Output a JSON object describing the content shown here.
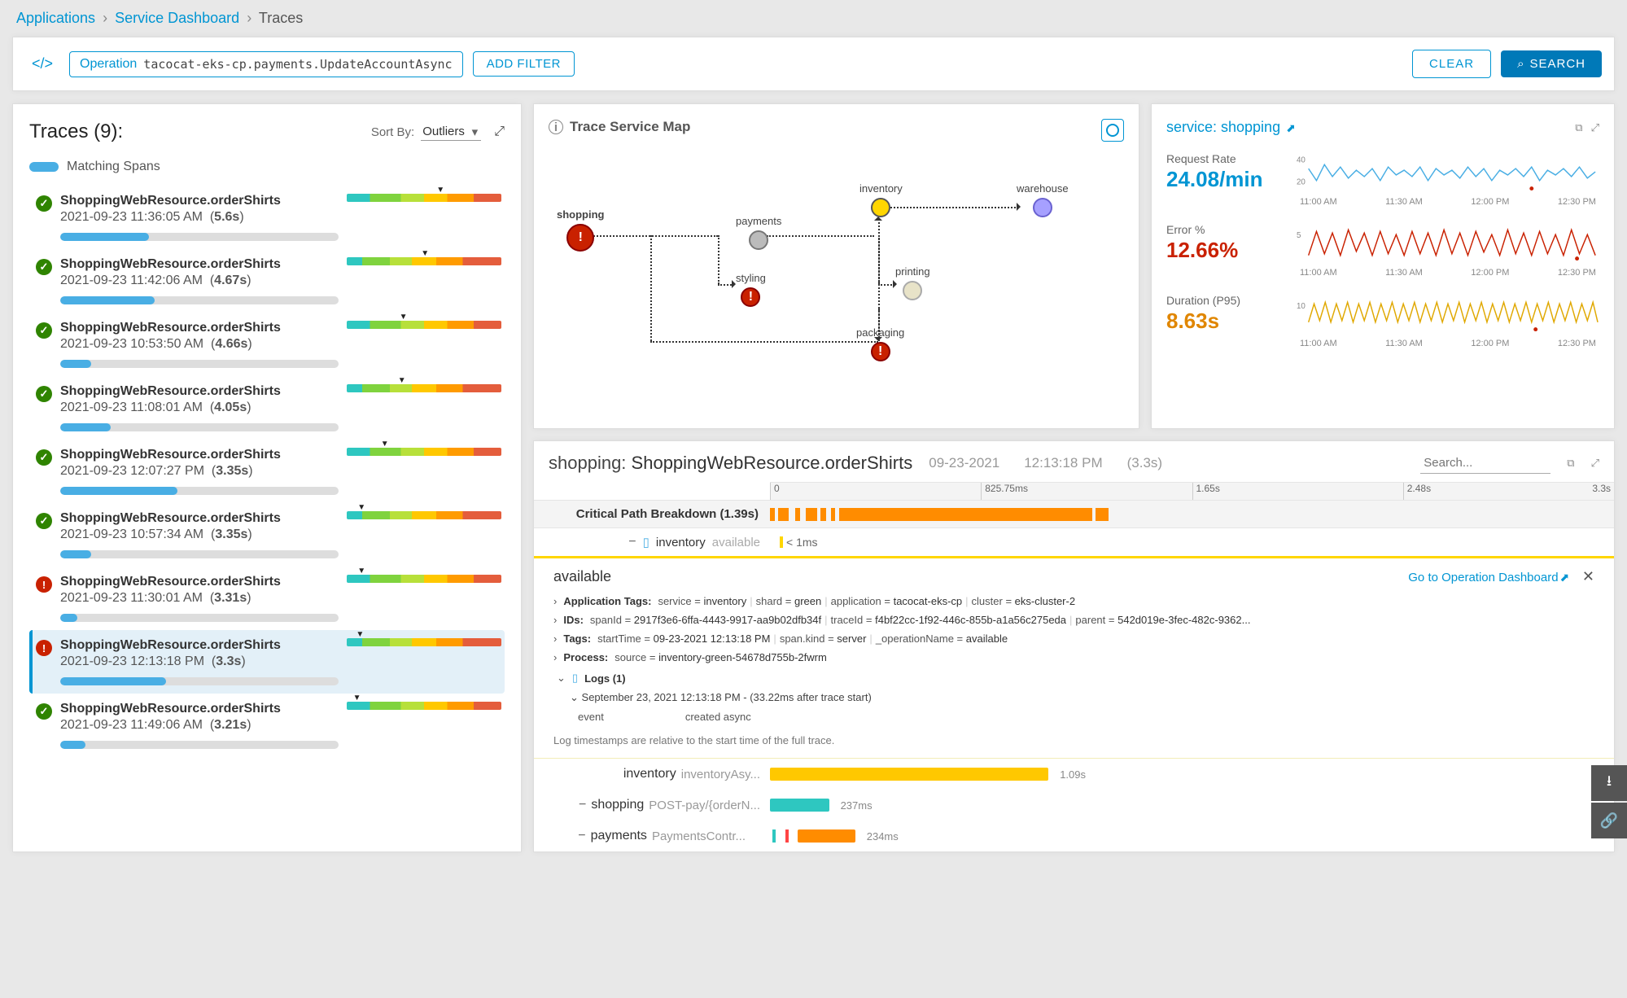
{
  "breadcrumb": {
    "items": [
      "Applications",
      "Service Dashboard",
      "Traces"
    ]
  },
  "filter": {
    "label": "Operation",
    "value": "tacocat-eks-cp.payments.UpdateAccountAsync",
    "addFilter": "ADD FILTER",
    "clear": "CLEAR",
    "search": "SEARCH"
  },
  "traces": {
    "title": "Traces (9):",
    "sortByLabel": "Sort By:",
    "sortByValue": "Outliers",
    "matching": "Matching Spans",
    "items": [
      {
        "name": "ShoppingWebResource.orderShirts",
        "ts": "2021-09-23 11:36:05 AM",
        "dur": "5.6s",
        "status": "ok",
        "marker": 58,
        "progress": 32
      },
      {
        "name": "ShoppingWebResource.orderShirts",
        "ts": "2021-09-23 11:42:06 AM",
        "dur": "4.67s",
        "status": "ok",
        "marker": 48,
        "progress": 34
      },
      {
        "name": "ShoppingWebResource.orderShirts",
        "ts": "2021-09-23 10:53:50 AM",
        "dur": "4.66s",
        "status": "ok",
        "marker": 34,
        "progress": 11
      },
      {
        "name": "ShoppingWebResource.orderShirts",
        "ts": "2021-09-23 11:08:01 AM",
        "dur": "4.05s",
        "status": "ok",
        "marker": 33,
        "progress": 18
      },
      {
        "name": "ShoppingWebResource.orderShirts",
        "ts": "2021-09-23 12:07:27 PM",
        "dur": "3.35s",
        "status": "ok",
        "marker": 22,
        "progress": 42
      },
      {
        "name": "ShoppingWebResource.orderShirts",
        "ts": "2021-09-23 10:57:34 AM",
        "dur": "3.35s",
        "status": "ok",
        "marker": 7,
        "progress": 11
      },
      {
        "name": "ShoppingWebResource.orderShirts",
        "ts": "2021-09-23 11:30:01 AM",
        "dur": "3.31s",
        "status": "err",
        "marker": 7,
        "progress": 6
      },
      {
        "name": "ShoppingWebResource.orderShirts",
        "ts": "2021-09-23 12:13:18 PM",
        "dur": "3.3s",
        "status": "err",
        "marker": 6,
        "progress": 38,
        "selected": true
      },
      {
        "name": "ShoppingWebResource.orderShirts",
        "ts": "2021-09-23 11:49:06 AM",
        "dur": "3.21s",
        "status": "ok",
        "marker": 4,
        "progress": 9
      }
    ]
  },
  "map": {
    "title": "Trace Service Map",
    "nodes": {
      "shopping": "shopping",
      "payments": "payments",
      "styling": "styling",
      "inventory": "inventory",
      "printing": "printing",
      "packaging": "packaging",
      "warehouse": "warehouse"
    }
  },
  "stats": {
    "link": "service: shopping",
    "requestRate": {
      "label": "Request Rate",
      "value": "24.08/min",
      "yticks": [
        "40",
        "20"
      ]
    },
    "errorPct": {
      "label": "Error %",
      "value": "12.66%",
      "yticks": [
        "5"
      ]
    },
    "duration": {
      "label": "Duration (P95)",
      "value": "8.63s",
      "yticks": [
        "10"
      ]
    },
    "xticks": [
      "11:00 AM",
      "11:30 AM",
      "12:00 PM",
      "12:30 PM"
    ]
  },
  "detail": {
    "title_service": "shopping:",
    "title_op": "ShoppingWebResource.orderShirts",
    "date": "09-23-2021",
    "time": "12:13:18 PM",
    "dur": "(3.3s)",
    "searchPlaceholder": "Search...",
    "ticks": [
      "0",
      "825.75ms",
      "1.65s",
      "2.48s",
      "3.3s"
    ],
    "critLabel": "Critical Path Breakdown (1.39s)",
    "inv_label": "inventory",
    "inv_status": "available",
    "inv_dur": "< 1ms",
    "span_title": "available",
    "dashboardLink": "Go to Operation Dashboard",
    "appTags": {
      "cat": "Application Tags:",
      "kv": [
        [
          "service",
          "inventory"
        ],
        [
          "shard",
          "green"
        ],
        [
          "application",
          "tacocat-eks-cp"
        ],
        [
          "cluster",
          "eks-cluster-2"
        ]
      ]
    },
    "ids": {
      "cat": "IDs:",
      "kv": [
        [
          "spanId",
          "2917f3e6-6ffa-4443-9917-aa9b02dfb34f"
        ],
        [
          "traceId",
          "f4bf22cc-1f92-446c-855b-a1a56c275eda"
        ],
        [
          "parent",
          "542d019e-3fec-482c-9362..."
        ]
      ]
    },
    "tags": {
      "cat": "Tags:",
      "kv": [
        [
          "startTime",
          "09-23-2021 12:13:18 PM"
        ],
        [
          "span.kind",
          "server"
        ],
        [
          "_operationName",
          "available"
        ]
      ]
    },
    "process": {
      "cat": "Process:",
      "kv": [
        [
          "source",
          "inventory-green-54678d755b-2fwrm"
        ]
      ]
    },
    "logs": {
      "label": "Logs  (1)",
      "ts": "September 23, 2021 12:13:18 PM - (33.22ms after trace start)",
      "event_k": "event",
      "event_v": "created async",
      "note": "Log timestamps are relative to the start time of the full trace."
    },
    "spans": [
      {
        "svc": "inventory",
        "op": "inventoryAsy...",
        "color": "#ffc800",
        "left": 0,
        "width": 33,
        "dur": "1.09s"
      },
      {
        "svc": "shopping",
        "op": "POST-pay/{orderN...",
        "color": "#2ec7c0",
        "left": 0,
        "width": 7,
        "dur": "237ms",
        "collapse": true
      },
      {
        "svc": "payments",
        "op": "PaymentsContr...",
        "color": "#ff8c00",
        "left": 0.3,
        "width": 6.8,
        "dur": "234ms",
        "collapse": true,
        "indent": true,
        "stripe": true
      }
    ]
  }
}
